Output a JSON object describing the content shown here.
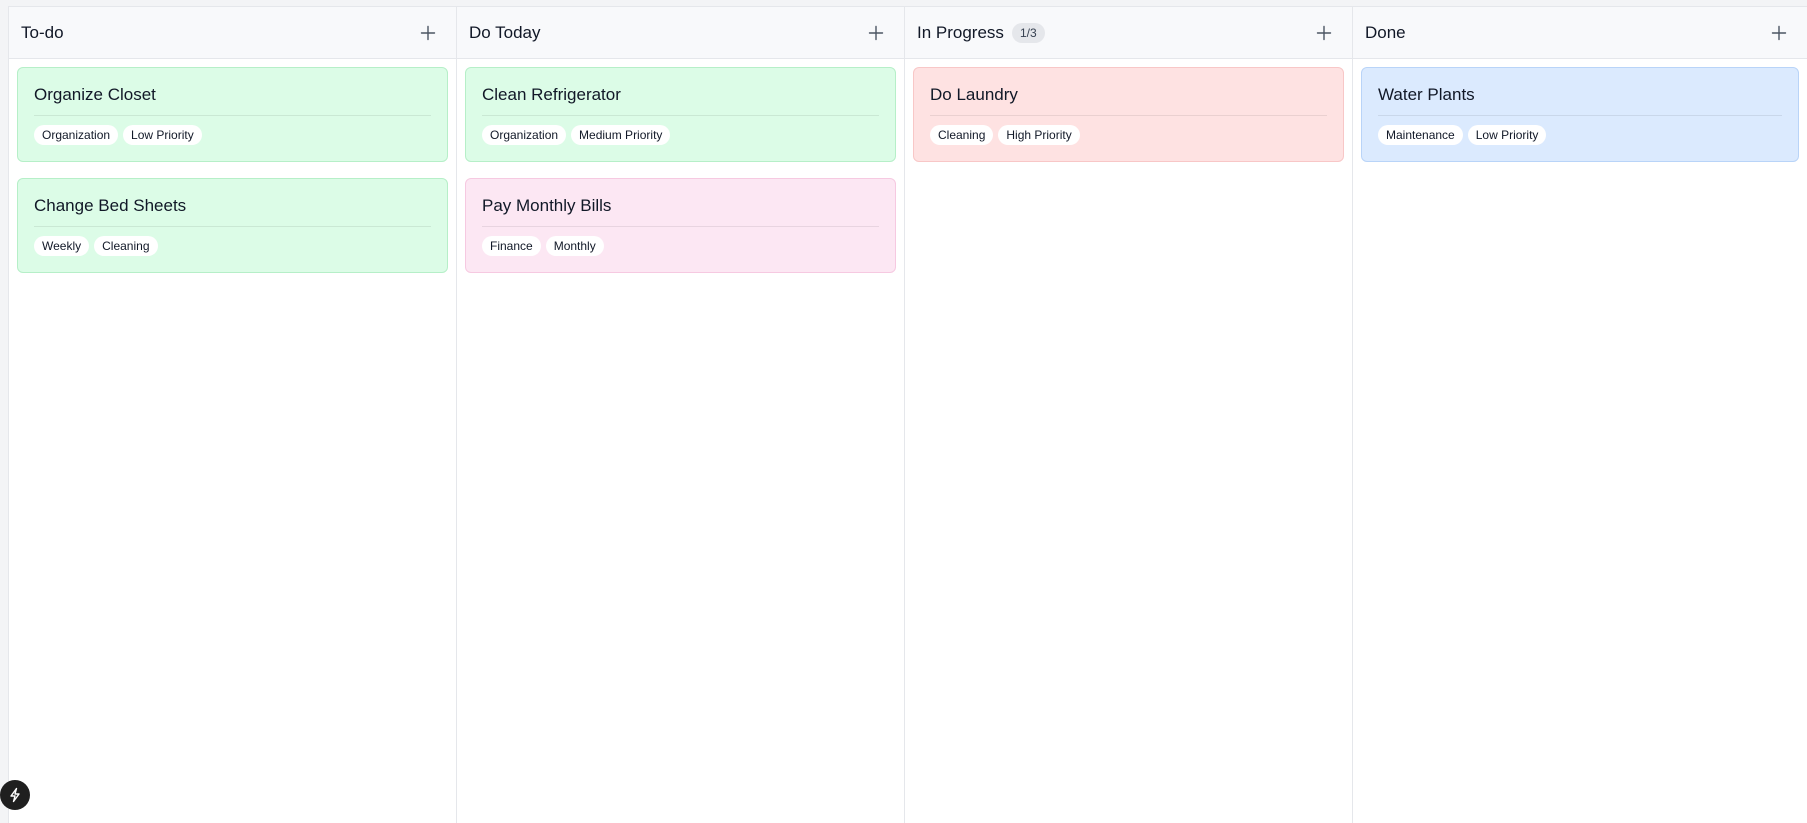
{
  "columns": [
    {
      "title": "To-do",
      "count": "",
      "cards": [
        {
          "title": "Organize Closet",
          "color": "green",
          "tags": [
            "Organization",
            "Low Priority"
          ]
        },
        {
          "title": "Change Bed Sheets",
          "color": "green",
          "tags": [
            "Weekly",
            "Cleaning"
          ]
        }
      ]
    },
    {
      "title": "Do Today",
      "count": "",
      "cards": [
        {
          "title": "Clean Refrigerator",
          "color": "green",
          "tags": [
            "Organization",
            "Medium Priority"
          ]
        },
        {
          "title": "Pay Monthly Bills",
          "color": "pink",
          "tags": [
            "Finance",
            "Monthly"
          ]
        }
      ]
    },
    {
      "title": "In Progress",
      "count": "1/3",
      "cards": [
        {
          "title": "Do Laundry",
          "color": "red",
          "tags": [
            "Cleaning",
            "High Priority"
          ]
        }
      ]
    },
    {
      "title": "Done",
      "count": "",
      "cards": [
        {
          "title": "Water Plants",
          "color": "blue",
          "tags": [
            "Maintenance",
            "Low Priority"
          ]
        }
      ]
    }
  ],
  "icons": {
    "add": "plus-icon",
    "fab": "lightning-icon"
  },
  "colors": {
    "green": "#dcfce7",
    "pink": "#fce7f3",
    "red": "#fee2e2",
    "blue": "#dbeafe"
  }
}
